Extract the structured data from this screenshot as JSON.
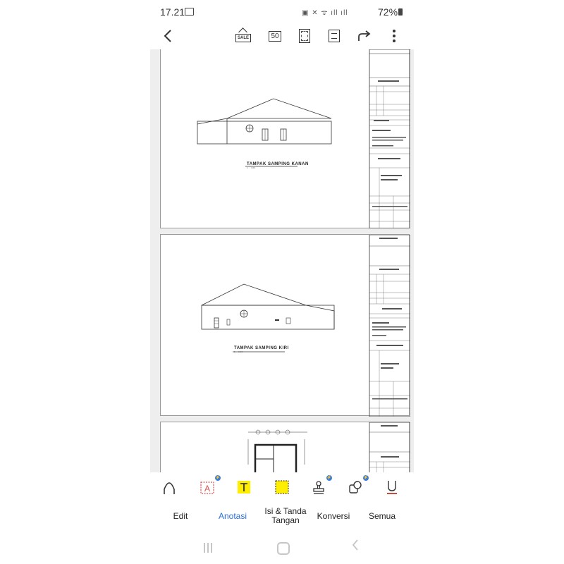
{
  "status_bar": {
    "time": "17.21",
    "network_icons": "▣ ✕ ᯤ ıll ıll",
    "battery": "72%"
  },
  "toolbar": {
    "back_icon": "chevron-left-icon",
    "sale_label": "SALE",
    "page_count": "50",
    "share_icon": "share-arrow-icon",
    "more_icon": "more-vertical-icon"
  },
  "document": {
    "pages": [
      {
        "drawing_title": "TAMPAK SAMPING KANAN",
        "scale": "1 : 100"
      },
      {
        "drawing_title": "TAMPAK SAMPING KIRI",
        "scale": "1 : 100"
      },
      {
        "drawing_title": "",
        "scale": ""
      }
    ]
  },
  "tools": [
    {
      "name": "edit-pen-icon",
      "color": "#333333"
    },
    {
      "name": "text-box-icon",
      "color": "#d9534f"
    },
    {
      "name": "text-highlight-icon",
      "color": "#ffee00"
    },
    {
      "name": "area-highlight-icon",
      "color": "#ffee00"
    },
    {
      "name": "stamp-icon",
      "color": "#333333"
    },
    {
      "name": "shapes-icon",
      "color": "#333333"
    },
    {
      "name": "underline-icon",
      "color": "#c0392b"
    }
  ],
  "tabs": {
    "edit": "Edit",
    "annotate": "Anotasi",
    "fill_sign": "Isi & Tanda Tangan",
    "convert": "Konversi",
    "all": "Semua"
  },
  "colors": {
    "accent": "#2f6fd6",
    "badge": "#3b7ddd"
  }
}
